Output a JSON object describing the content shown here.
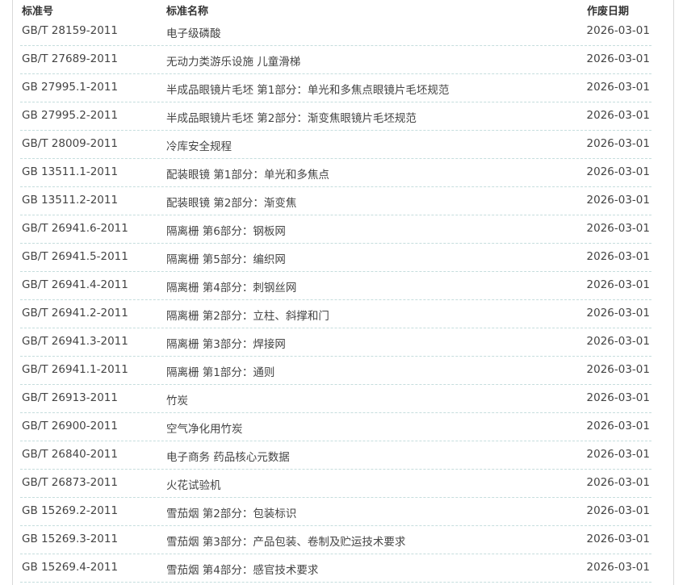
{
  "table": {
    "headers": {
      "code": "标准号",
      "name": "标准名称",
      "date": "作废日期"
    },
    "rows": [
      {
        "code": "GB/T 28159-2011",
        "name": "电子级磷酸",
        "date": "2026-03-01"
      },
      {
        "code": "GB/T 27689-2011",
        "name": "无动力类游乐设施 儿童滑梯",
        "date": "2026-03-01"
      },
      {
        "code": "GB 27995.1-2011",
        "name": "半成品眼镜片毛坯 第1部分：单光和多焦点眼镜片毛坯规范",
        "date": "2026-03-01"
      },
      {
        "code": "GB 27995.2-2011",
        "name": "半成品眼镜片毛坯 第2部分：渐变焦眼镜片毛坯规范",
        "date": "2026-03-01"
      },
      {
        "code": "GB/T 28009-2011",
        "name": "冷库安全规程",
        "date": "2026-03-01"
      },
      {
        "code": "GB 13511.1-2011",
        "name": "配装眼镜 第1部分：单光和多焦点",
        "date": "2026-03-01"
      },
      {
        "code": "GB 13511.2-2011",
        "name": "配装眼镜 第2部分：渐变焦",
        "date": "2026-03-01"
      },
      {
        "code": "GB/T 26941.6-2011",
        "name": "隔离栅 第6部分：钢板网",
        "date": "2026-03-01"
      },
      {
        "code": "GB/T 26941.5-2011",
        "name": "隔离栅 第5部分：编织网",
        "date": "2026-03-01"
      },
      {
        "code": "GB/T 26941.4-2011",
        "name": "隔离栅 第4部分：刺钢丝网",
        "date": "2026-03-01"
      },
      {
        "code": "GB/T 26941.2-2011",
        "name": "隔离栅 第2部分：立柱、斜撑和门",
        "date": "2026-03-01"
      },
      {
        "code": "GB/T 26941.3-2011",
        "name": "隔离栅 第3部分：焊接网",
        "date": "2026-03-01"
      },
      {
        "code": "GB/T 26941.1-2011",
        "name": "隔离栅 第1部分：通则",
        "date": "2026-03-01"
      },
      {
        "code": "GB/T 26913-2011",
        "name": "竹炭",
        "date": "2026-03-01"
      },
      {
        "code": "GB/T 26900-2011",
        "name": "空气净化用竹炭",
        "date": "2026-03-01"
      },
      {
        "code": "GB/T 26840-2011",
        "name": "电子商务 药品核心元数据",
        "date": "2026-03-01"
      },
      {
        "code": "GB/T 26873-2011",
        "name": "火花试验机",
        "date": "2026-03-01"
      },
      {
        "code": "GB 15269.2-2011",
        "name": "雪茄烟 第2部分：包装标识",
        "date": "2026-03-01"
      },
      {
        "code": "GB 15269.3-2011",
        "name": "雪茄烟 第3部分：产品包装、卷制及贮运技术要求",
        "date": "2026-03-01"
      },
      {
        "code": "GB 15269.4-2011",
        "name": "雪茄烟 第4部分：感官技术要求",
        "date": "2026-03-01"
      }
    ]
  }
}
